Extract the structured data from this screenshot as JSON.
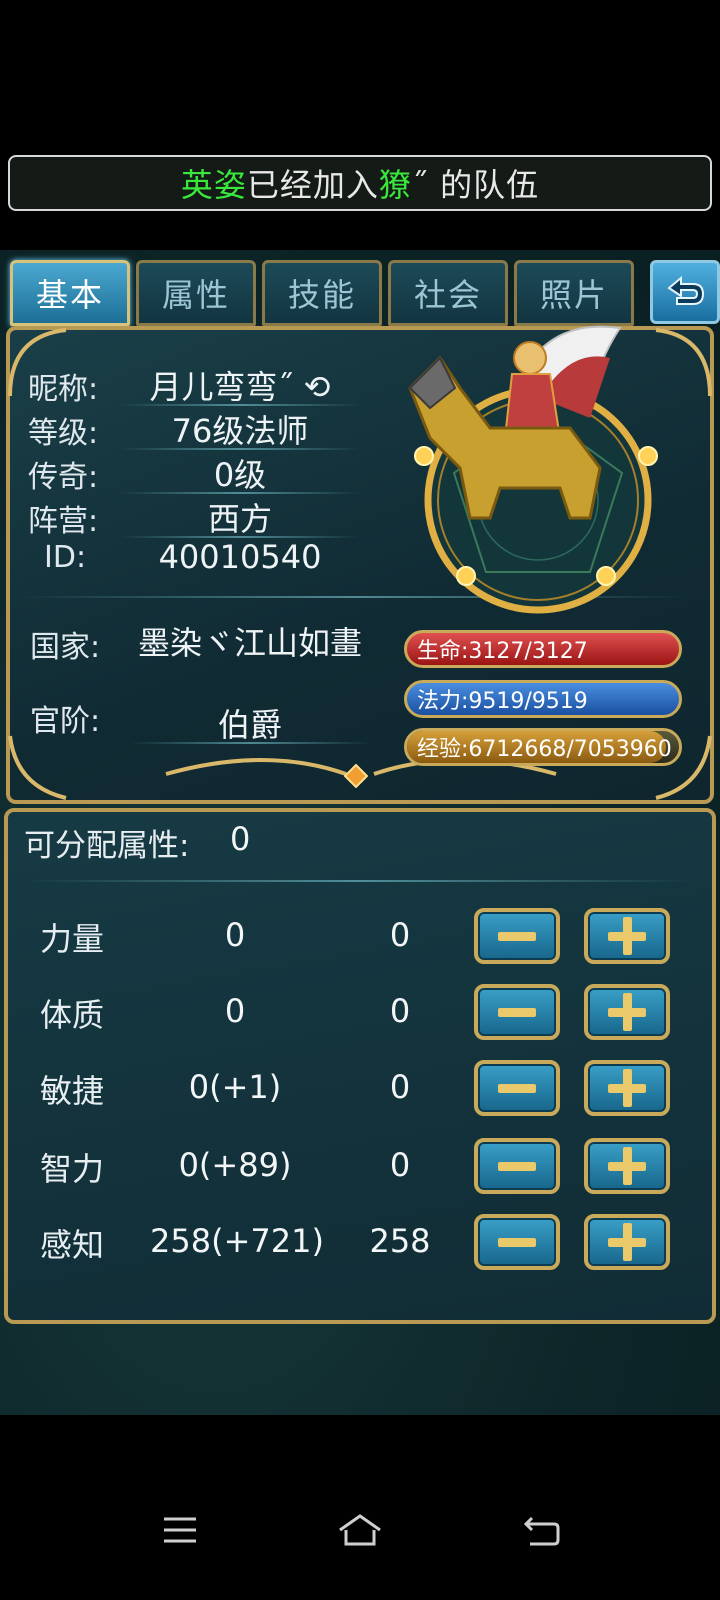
{
  "notice": {
    "name_green": "英姿",
    "text1": "已经加入",
    "name2_green": "獠",
    "text2": "˝ 的队伍"
  },
  "tabs": [
    {
      "label": "基本",
      "active": true
    },
    {
      "label": "属性",
      "active": false
    },
    {
      "label": "技能",
      "active": false
    },
    {
      "label": "社会",
      "active": false
    },
    {
      "label": "照片",
      "active": false
    }
  ],
  "profile": {
    "nickname_label": "昵称:",
    "nickname": "月儿弯弯˝ ⟲",
    "level_label": "等级:",
    "level": "76级法师",
    "legend_label": "传奇:",
    "legend": "0级",
    "camp_label": "阵营:",
    "camp": "西方",
    "id_label": "ID:",
    "id": "40010540",
    "country_label": "国家:",
    "country": "墨染ヾ江山如畫",
    "rank_label": "官阶:",
    "rank": "伯爵"
  },
  "stats": {
    "hp": "生命:3127/3127",
    "mp": "法力:9519/9519",
    "exp": "经验:6712668/7053960",
    "exp_fraction": 0.9516
  },
  "attributes": {
    "points_label": "可分配属性:",
    "points": "0",
    "rows": [
      {
        "name": "力量",
        "current": "0",
        "pending": "0"
      },
      {
        "name": "体质",
        "current": "0",
        "pending": "0"
      },
      {
        "name": "敏捷",
        "current": "0(+1)",
        "pending": "0"
      },
      {
        "name": "智力",
        "current": "0(+89)",
        "pending": "0"
      },
      {
        "name": "感知",
        "current": "258(+721)",
        "pending": "258"
      }
    ]
  },
  "colors": {
    "accent_gold": "#c9a95a",
    "panel_bg": "#12303a",
    "hp_red": "#b41c1c",
    "mp_blue": "#2a64c0",
    "notice_green": "#39e83b"
  }
}
